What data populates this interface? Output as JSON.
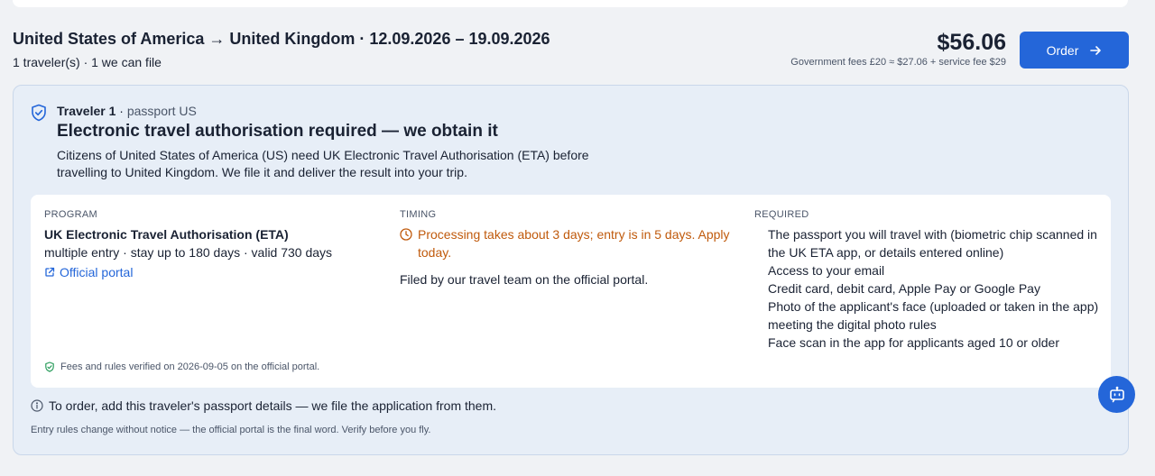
{
  "trip": {
    "title": "United States of America → United Kingdom · 12.09.2026 – 19.09.2026",
    "subtitle": "1 traveler(s) · 1 we can file"
  },
  "pricing": {
    "total": "$56.06",
    "fees_note": "Government fees £20 ≈ $27.06 + service fee $29",
    "order_label": "Order"
  },
  "traveler": {
    "label": "Traveler 1",
    "separator": " · ",
    "passport": "passport US",
    "heading": "Electronic travel authorisation required — we obtain it",
    "description": "Citizens of United States of America (US) need UK Electronic Travel Authorisation (ETA) before travelling to United Kingdom. We file it and deliver the result into your trip."
  },
  "program": {
    "label": "PROGRAM",
    "name": "UK Electronic Travel Authorisation (ETA)",
    "details": "multiple entry · stay up to 180 days · valid 730 days",
    "portal_link": "Official portal"
  },
  "timing": {
    "label": "TIMING",
    "warning": "Processing takes about 3 days; entry is in 5 days. Apply today.",
    "filed_by": "Filed by our travel team on the official portal."
  },
  "required": {
    "label": "REQUIRED",
    "items": [
      "The passport you will travel with (biometric chip scanned in the UK ETA app, or details entered online)",
      "Access to your email",
      "Credit card, debit card, Apple Pay or Google Pay",
      "Photo of the applicant's face (uploaded or taken in the app) meeting the digital photo rules",
      "Face scan in the app for applicants aged 10 or older"
    ]
  },
  "verified_note": "Fees and rules verified on 2026-09-05 on the official portal.",
  "order_note": "To order, add this traveler's passport details — we file the application from them.",
  "disclaimer": "Entry rules change without notice — the official portal is the final word. Verify before you fly.",
  "icons": {
    "shield": "shield-check-icon",
    "external": "external-link-icon",
    "clock": "clock-icon",
    "verified": "verified-shield-icon",
    "info": "info-icon",
    "arrow": "arrow-right-icon",
    "chat": "chat-bot-icon"
  },
  "colors": {
    "accent": "#2466d9",
    "warning": "#c05a0c",
    "panel_bg": "#e7eef7"
  }
}
